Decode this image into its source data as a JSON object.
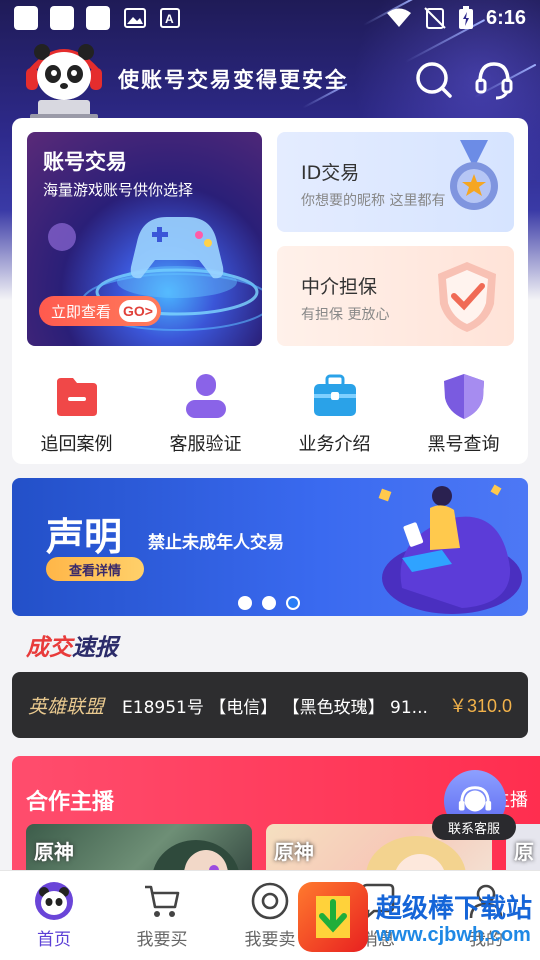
{
  "status_bar": {
    "time": "6:16"
  },
  "header": {
    "slogan": "使账号交易变得更安全"
  },
  "promos": {
    "account_trade": {
      "title": "账号交易",
      "subtitle": "海量游戏账号供你选择",
      "button_label": "立即查看",
      "go_label": "GO>"
    },
    "id_trade": {
      "title": "ID交易",
      "subtitle": "你想要的昵称 这里都有"
    },
    "escrow": {
      "title": "中介担保",
      "subtitle": "有担保 更放心"
    }
  },
  "quick_actions": [
    {
      "label": "追回案例",
      "icon": "folder-icon",
      "color": "#f04848"
    },
    {
      "label": "客服验证",
      "icon": "user-icon",
      "color": "#8a63e8"
    },
    {
      "label": "业务介绍",
      "icon": "briefcase-icon",
      "color": "#2aa2e8"
    },
    {
      "label": "黑号查询",
      "icon": "shield-icon",
      "color": "#7a5be0"
    }
  ],
  "banner": {
    "title": "声明",
    "subtitle": "禁止未成年人交易",
    "button_label": "查看详情",
    "active_slide": 3,
    "slide_count": 3
  },
  "deals": {
    "title_part1": "成交",
    "title_part2": "速报",
    "game": "英雄联盟",
    "description": "E18951号 【电信】 【黑色玫瑰】 91...",
    "price": "￥310.0"
  },
  "streamers": {
    "title": "合作主播",
    "more_label": "主播",
    "card_logos": [
      "原神",
      "原神",
      "原"
    ]
  },
  "service_float": {
    "label": "联系客服"
  },
  "bottom_nav": [
    {
      "label": "首页",
      "icon": "panda-home-icon",
      "active": true
    },
    {
      "label": "我要买",
      "icon": "cart-icon",
      "active": false
    },
    {
      "label": "我要卖",
      "icon": "sell-circle-icon",
      "active": false
    },
    {
      "label": "消息",
      "icon": "message-icon",
      "active": false
    },
    {
      "label": "我的",
      "icon": "profile-icon",
      "active": false
    }
  ],
  "watermark": {
    "name": "超级棒下载站",
    "url": "www.cjbwh.com"
  }
}
